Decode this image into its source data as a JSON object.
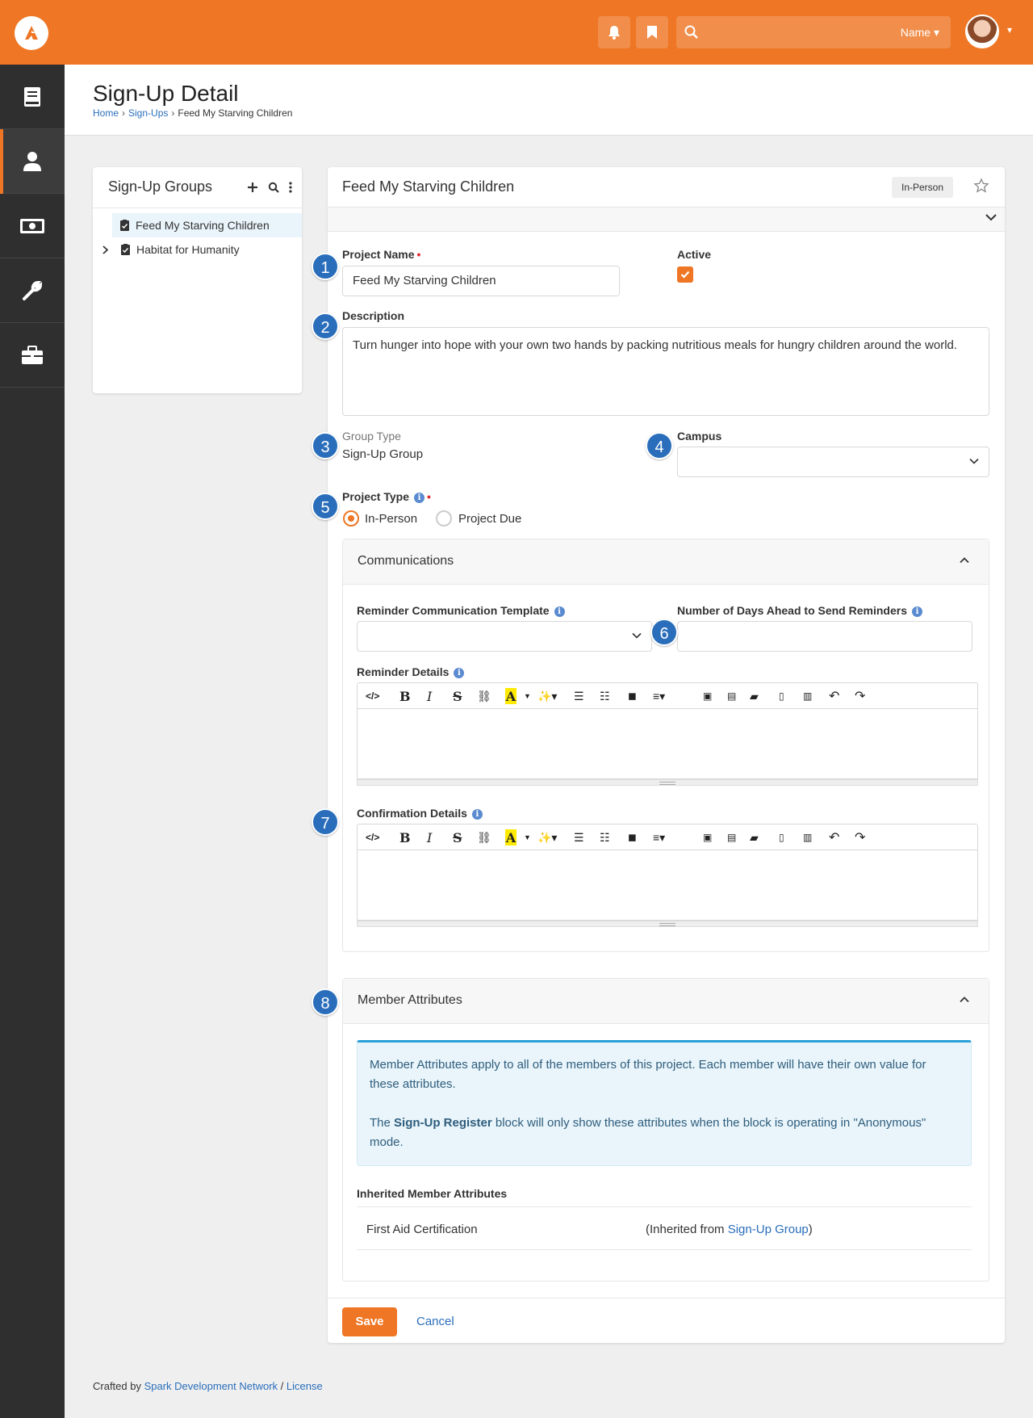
{
  "topbar": {
    "search_scope": "Name",
    "colors": {
      "brand": "#ee7624",
      "link": "#2a6ebb",
      "marker": "#2a6ebb"
    }
  },
  "sidenav": {
    "icons": [
      "book-icon",
      "person-icon",
      "money-icon",
      "wrench-icon",
      "briefcase-icon"
    ]
  },
  "page": {
    "title": "Sign-Up Detail",
    "breadcrumb": [
      "Home",
      "Sign-Ups",
      "Feed My Starving Children"
    ]
  },
  "tree": {
    "title": "Sign-Up Groups",
    "items": [
      {
        "label": "Feed My Starving Children",
        "selected": true
      },
      {
        "label": "Habitat for Humanity",
        "selected": false
      }
    ]
  },
  "detail": {
    "title": "Feed My Starving Children",
    "badge": "In-Person",
    "project_name_label": "Project Name",
    "project_name_value": "Feed My Starving Children",
    "active_label": "Active",
    "active_checked": true,
    "description_label": "Description",
    "description_value": "Turn hunger into hope with your own two hands by packing nutritious meals for hungry children around the world.",
    "group_type_label": "Group Type",
    "group_type_value": "Sign-Up Group",
    "campus_label": "Campus",
    "campus_value": "",
    "project_type_label": "Project Type",
    "project_type_options": [
      "In-Person",
      "Project Due"
    ],
    "project_type_selected": "In-Person"
  },
  "communications": {
    "title": "Communications",
    "reminder_template_label": "Reminder Communication Template",
    "reminder_template_value": "",
    "days_ahead_label": "Number of Days Ahead to Send Reminders",
    "days_ahead_value": "",
    "reminder_details_label": "Reminder Details",
    "confirmation_details_label": "Confirmation Details"
  },
  "member_attributes": {
    "title": "Member Attributes",
    "alert_p1": "Member Attributes apply to all of the members of this project. Each member will have their own value for these attributes.",
    "alert_p2_prefix": "The ",
    "alert_p2_bold": "Sign-Up Register",
    "alert_p2_suffix": " block will only show these attributes when the block is operating in \"Anonymous\" mode.",
    "inherited_header": "Inherited Member Attributes",
    "rows": [
      {
        "name": "First Aid Certification",
        "inherited_prefix": "(Inherited from ",
        "inherited_link": "Sign-Up Group",
        "inherited_suffix": ")"
      }
    ]
  },
  "actions": {
    "save": "Save",
    "cancel": "Cancel"
  },
  "markers": [
    "1",
    "2",
    "3",
    "4",
    "5",
    "6",
    "7",
    "8"
  ],
  "footer": {
    "prefix": "Crafted by ",
    "org": "Spark Development Network",
    "sep": " / ",
    "license": "License"
  }
}
